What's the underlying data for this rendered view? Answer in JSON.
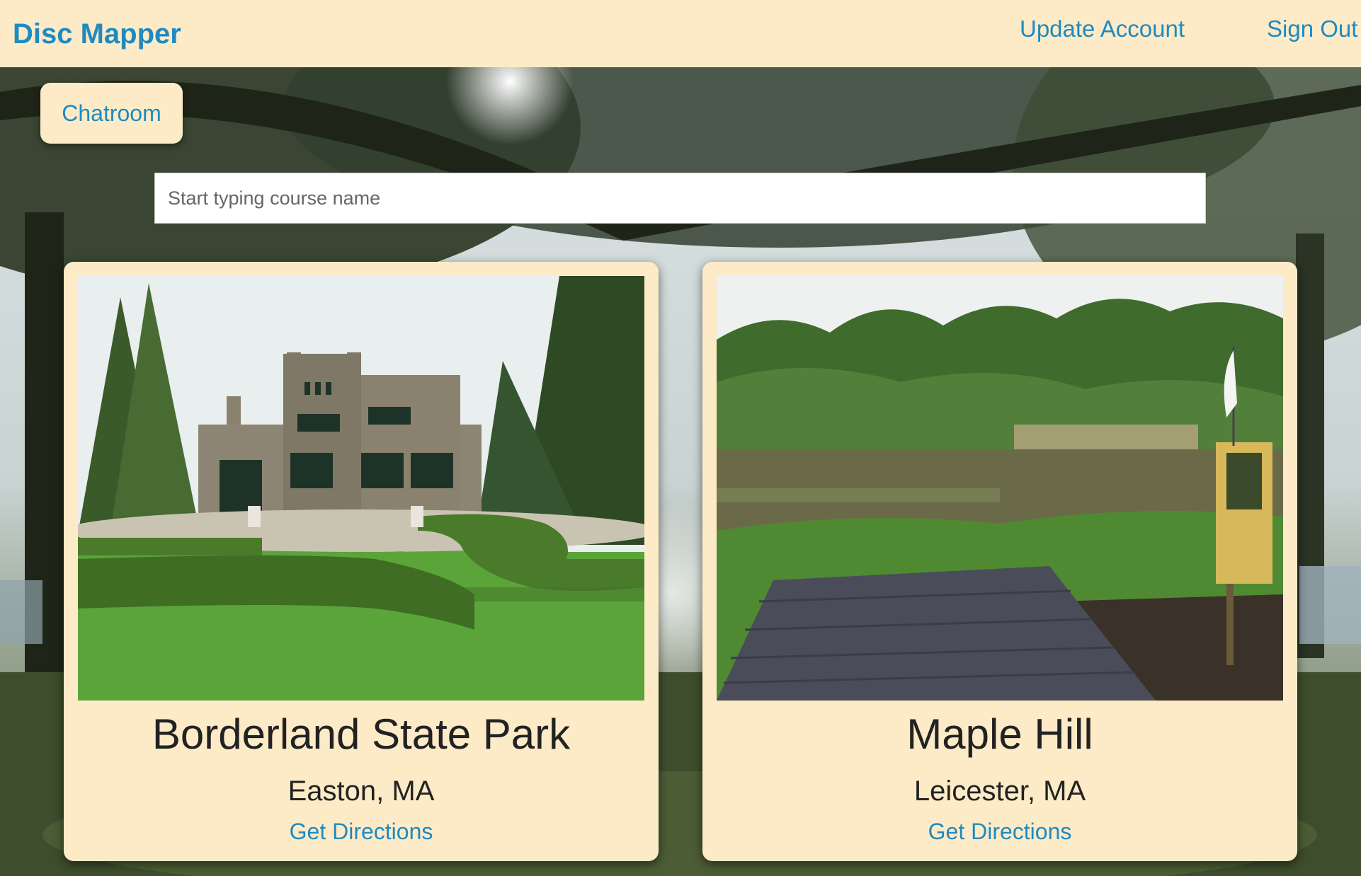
{
  "navbar": {
    "brand": "Disc Mapper",
    "update_account": "Update Account",
    "sign_out": "Sign Out"
  },
  "chatroom": {
    "label": "Chatroom"
  },
  "search": {
    "placeholder": "Start typing course name",
    "value": ""
  },
  "courses": [
    {
      "name": "Borderland State Park",
      "location": "Easton, MA",
      "directions": "Get Directions"
    },
    {
      "name": "Maple Hill",
      "location": "Leicester, MA",
      "directions": "Get Directions"
    }
  ],
  "colors": {
    "navbar_bg": "#fdebc8",
    "link": "#1f8ac0",
    "card_bg": "#fdebc8",
    "text": "#222222"
  }
}
